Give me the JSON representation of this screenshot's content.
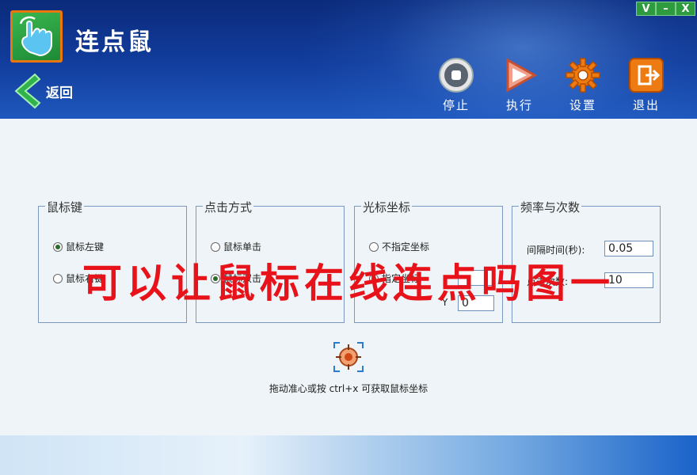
{
  "app": {
    "title": "连点鼠"
  },
  "window": {
    "minimize": "V",
    "restore": "–",
    "close": "X"
  },
  "nav": {
    "back_label": "返回"
  },
  "toolbar": {
    "stop": "停止",
    "run": "执行",
    "settings": "设置",
    "exit": "退出"
  },
  "groups": {
    "mouse_button": {
      "legend": "鼠标键",
      "left": "鼠标左键",
      "right": "鼠标右键"
    },
    "click_mode": {
      "legend": "点击方式",
      "single": "鼠标单击",
      "double": "鼠标双击"
    },
    "cursor_pos": {
      "legend": "光标坐标",
      "unspecified": "不指定坐标",
      "specified": "指定坐标",
      "y_label": "Y",
      "x_value": "",
      "y_value": "0"
    },
    "frequency": {
      "legend": "频率与次数",
      "interval_label": "间隔时间(秒):",
      "interval_value": "0.05",
      "count_label": "点击次数:",
      "count_value": "10"
    }
  },
  "hint": "拖动准心或按 ctrl+x 可获取鼠标坐标",
  "overlay_text": "可以让鼠标在线连点吗图一",
  "colors": {
    "header": "#123e9e",
    "overlay": "#e8131a",
    "stop": "#d8d8d8",
    "run": "#e0603a",
    "settings": "#e8740f",
    "exit": "#e8740f"
  }
}
